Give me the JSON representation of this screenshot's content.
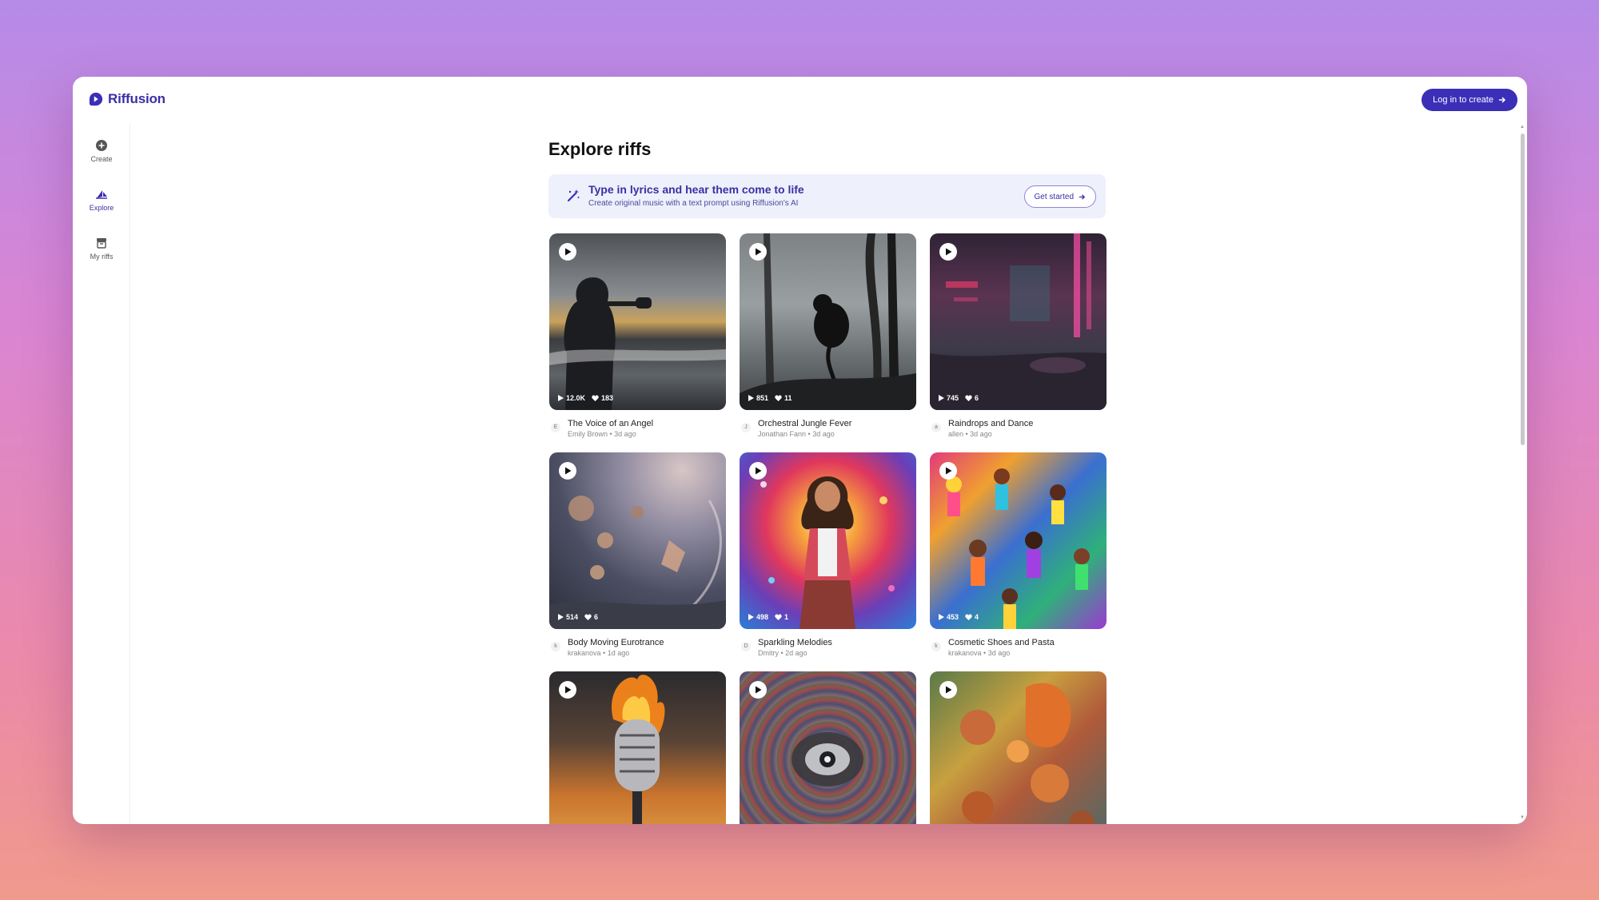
{
  "app": {
    "name": "Riffusion"
  },
  "header": {
    "login_label": "Log in to create"
  },
  "sidebar": {
    "items": [
      {
        "label": "Create",
        "icon": "plus-circle-icon",
        "active": false
      },
      {
        "label": "Explore",
        "icon": "sail-icon",
        "active": true
      },
      {
        "label": "My riffs",
        "icon": "archive-icon",
        "active": false
      }
    ]
  },
  "main": {
    "title": "Explore riffs",
    "banner": {
      "icon": "magic-wand-icon",
      "title": "Type in lyrics and hear them come to life",
      "subtitle": "Create original music with a text prompt using Riffusion's AI",
      "button_label": "Get started"
    }
  },
  "riffs": [
    {
      "title": "The Voice of an Angel",
      "author": "Emily Brown",
      "age": "3d ago",
      "initial": "E",
      "plays": "12.0K",
      "likes": "183"
    },
    {
      "title": "Orchestral Jungle Fever",
      "author": "Jonathan Fann",
      "age": "3d ago",
      "initial": "J",
      "plays": "851",
      "likes": "11"
    },
    {
      "title": "Raindrops and Dance",
      "author": "allen",
      "age": "3d ago",
      "initial": "a",
      "plays": "745",
      "likes": "6"
    },
    {
      "title": "Body Moving Eurotrance",
      "author": "krakanova",
      "age": "1d ago",
      "initial": "k",
      "plays": "514",
      "likes": "6"
    },
    {
      "title": "Sparkling Melodies",
      "author": "Dmitry",
      "age": "2d ago",
      "initial": "D",
      "plays": "498",
      "likes": "1"
    },
    {
      "title": "Cosmetic Shoes and Pasta",
      "author": "krakanova",
      "age": "3d ago",
      "initial": "k",
      "plays": "453",
      "likes": "4"
    },
    {
      "title": "",
      "author": "",
      "age": "",
      "initial": "",
      "plays": "",
      "likes": ""
    },
    {
      "title": "",
      "author": "",
      "age": "",
      "initial": "",
      "plays": "",
      "likes": ""
    },
    {
      "title": "",
      "author": "",
      "age": "",
      "initial": "",
      "plays": "",
      "likes": ""
    }
  ],
  "colors": {
    "accent": "#3b2fb8",
    "banner_bg": "#eef0fb"
  }
}
